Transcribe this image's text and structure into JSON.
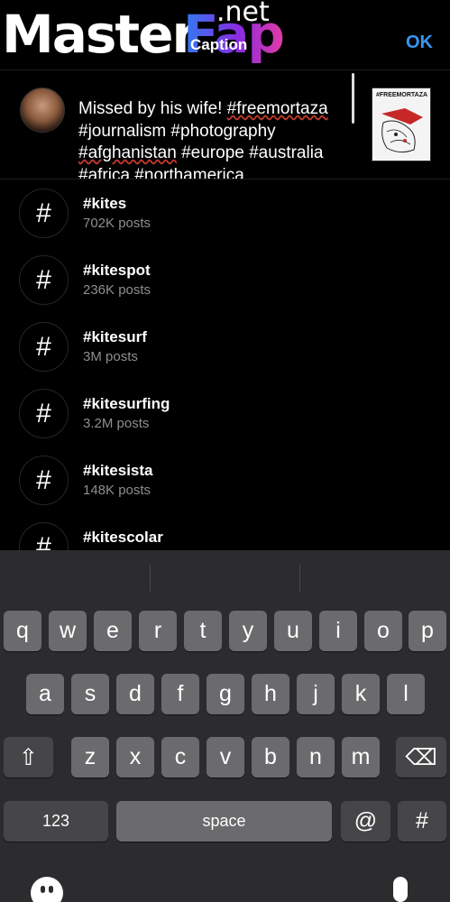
{
  "watermark": {
    "master": "Master",
    "fap": "Fap",
    "net": ".net"
  },
  "header": {
    "title": "Caption",
    "ok_label": "OK"
  },
  "caption": {
    "text_before": "Missed by his wife! ",
    "tag1": "#freemortaza",
    "text_mid": " #journalism #photography ",
    "tag2": "#afghanistan",
    "text_after": " #europe #australia #africa #northamerica",
    "thumbnail_title": "#FREEMORTAZA"
  },
  "suggestions": [
    {
      "tag": "#kites",
      "count": "702K posts"
    },
    {
      "tag": "#kitespot",
      "count": "236K posts"
    },
    {
      "tag": "#kitesurf",
      "count": "3M posts"
    },
    {
      "tag": "#kitesurfing",
      "count": "3.2M posts"
    },
    {
      "tag": "#kitesista",
      "count": "148K posts"
    },
    {
      "tag": "#kitescolar",
      "count": ""
    }
  ],
  "hash_symbol": "#",
  "keyboard": {
    "row1": [
      "q",
      "w",
      "e",
      "r",
      "t",
      "y",
      "u",
      "i",
      "o",
      "p"
    ],
    "row2": [
      "a",
      "s",
      "d",
      "f",
      "g",
      "h",
      "j",
      "k",
      "l"
    ],
    "row3": [
      "z",
      "x",
      "c",
      "v",
      "b",
      "n",
      "m"
    ],
    "numbers_label": "123",
    "space_label": "space",
    "at_label": "@",
    "hash_label": "#",
    "shift_icon": "⇧",
    "delete_icon": "⌫"
  }
}
